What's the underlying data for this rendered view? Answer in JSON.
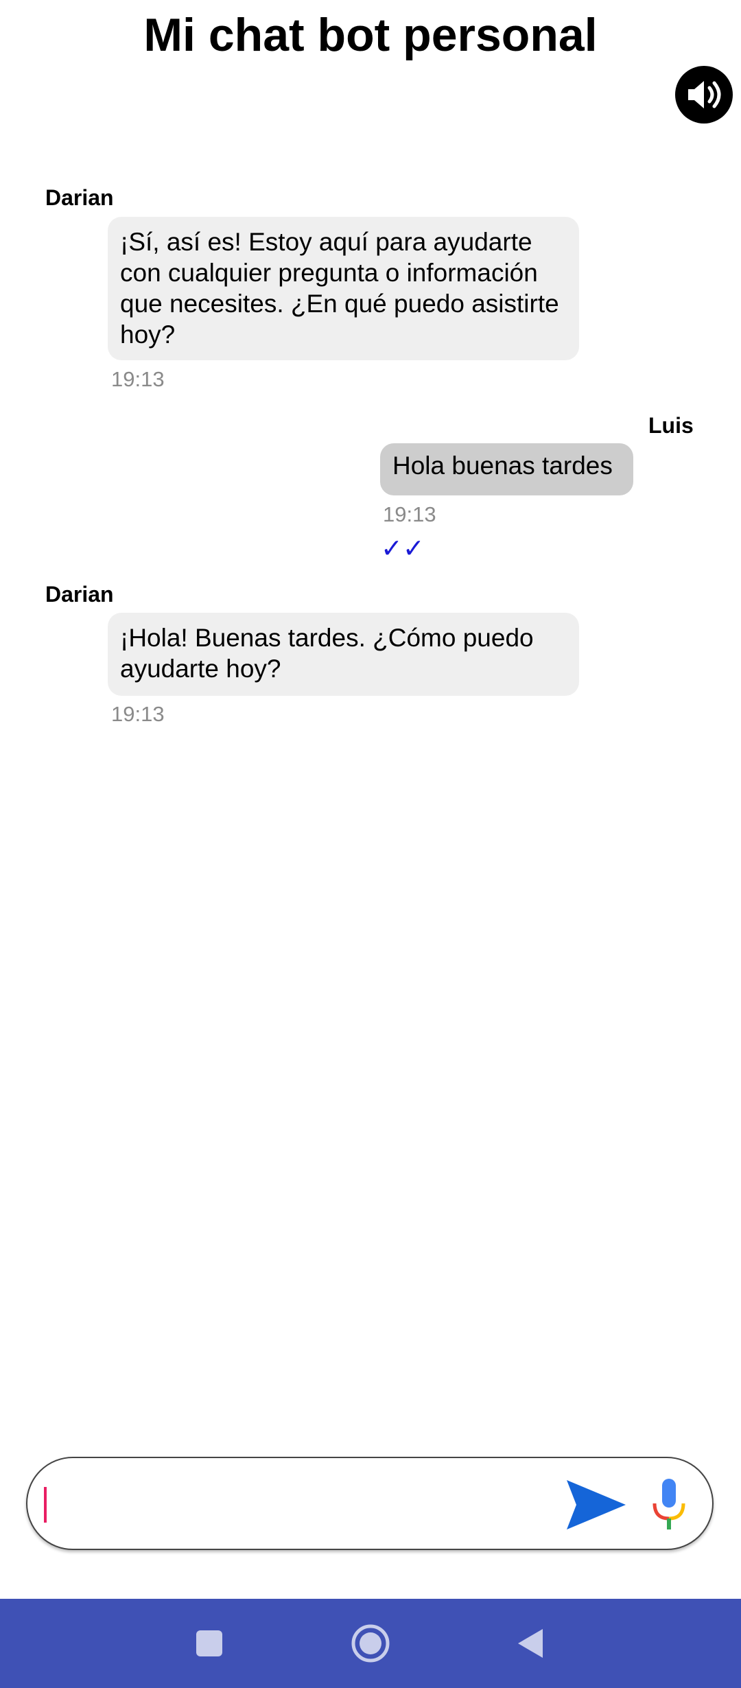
{
  "header": {
    "title": "Mi chat bot personal",
    "speaker_icon": "speaker-volume-icon"
  },
  "messages": [
    {
      "sender": "Darian",
      "role": "bot",
      "text": "¡Sí, así es! Estoy aquí para ayudarte con cualquier pregunta o información que necesites. ¿En qué puedo asistirte hoy?",
      "time": "19:13"
    },
    {
      "sender": "Luis",
      "role": "user",
      "text": "Hola buenas tardes",
      "time": "19:13",
      "status": "✓✓"
    },
    {
      "sender": "Darian",
      "role": "bot",
      "text": "¡Hola! Buenas tardes. ¿Cómo puedo ayudarte hoy?",
      "time": "19:13"
    }
  ],
  "composer": {
    "value": "",
    "placeholder": "",
    "send_icon": "send-icon",
    "mic_icon": "microphone-icon"
  },
  "colors": {
    "bot_bubble": "#efefef",
    "user_bubble": "#cdcdcd",
    "read_ticks": "#1a1ad6",
    "send_button": "#1565d8",
    "caret": "#e91e63",
    "nav_bar": "#3f51b5"
  },
  "system_nav": {
    "recents_icon": "square-recents-icon",
    "home_icon": "circle-home-icon",
    "back_icon": "triangle-back-icon"
  }
}
